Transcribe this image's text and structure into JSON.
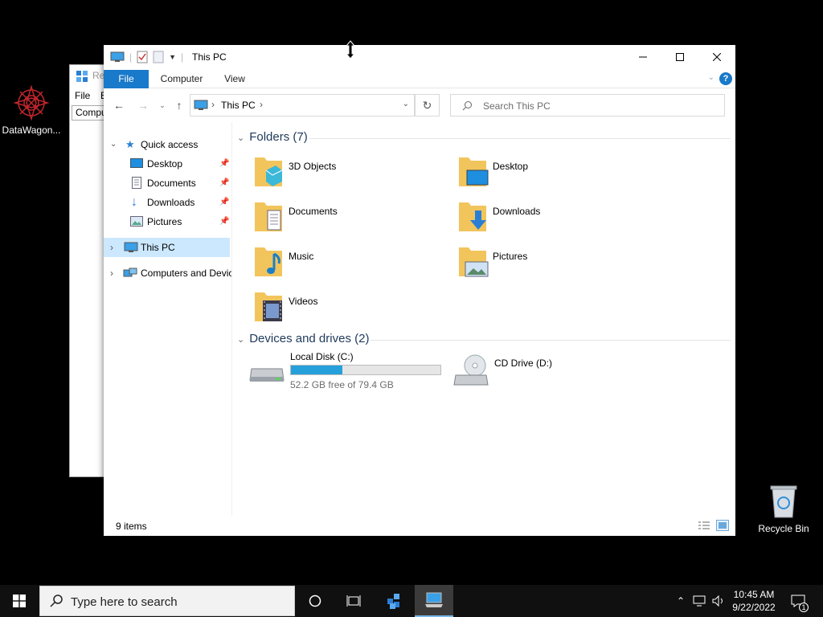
{
  "desktop": {
    "icons": [
      {
        "label": "DataWagon..."
      },
      {
        "label": "Recycle Bin"
      }
    ]
  },
  "background_window": {
    "title": "Re",
    "menu_file": "File",
    "menu_edit": "E",
    "address": "Compu"
  },
  "window": {
    "title": "This PC",
    "ribbon": {
      "file": "File",
      "computer": "Computer",
      "view": "View"
    },
    "address": {
      "crumb": "This PC"
    },
    "search": {
      "placeholder": "Search This PC"
    },
    "nav": {
      "quick_access": "Quick access",
      "items": [
        {
          "label": "Desktop"
        },
        {
          "label": "Documents"
        },
        {
          "label": "Downloads"
        },
        {
          "label": "Pictures"
        }
      ],
      "this_pc": "This PC",
      "network": "Computers and Devic"
    },
    "folders_header": "Folders (7)",
    "folders": [
      {
        "name": "3D Objects"
      },
      {
        "name": "Desktop"
      },
      {
        "name": "Documents"
      },
      {
        "name": "Downloads"
      },
      {
        "name": "Music"
      },
      {
        "name": "Pictures"
      },
      {
        "name": "Videos"
      }
    ],
    "drives_header": "Devices and drives (2)",
    "drives": [
      {
        "name": "Local Disk (C:)",
        "free_text": "52.2 GB free of 79.4 GB",
        "used_fraction": 0.343
      },
      {
        "name": "CD Drive (D:)"
      }
    ],
    "status": {
      "count": "9 items"
    }
  },
  "taskbar": {
    "search_placeholder": "Type here to search",
    "time": "10:45 AM",
    "date": "9/22/2022",
    "notification_count": "1"
  },
  "colors": {
    "accent": "#1979ca",
    "selection": "#cce8ff",
    "drive_bar": "#26a0da",
    "header_text": "#1e395b"
  }
}
